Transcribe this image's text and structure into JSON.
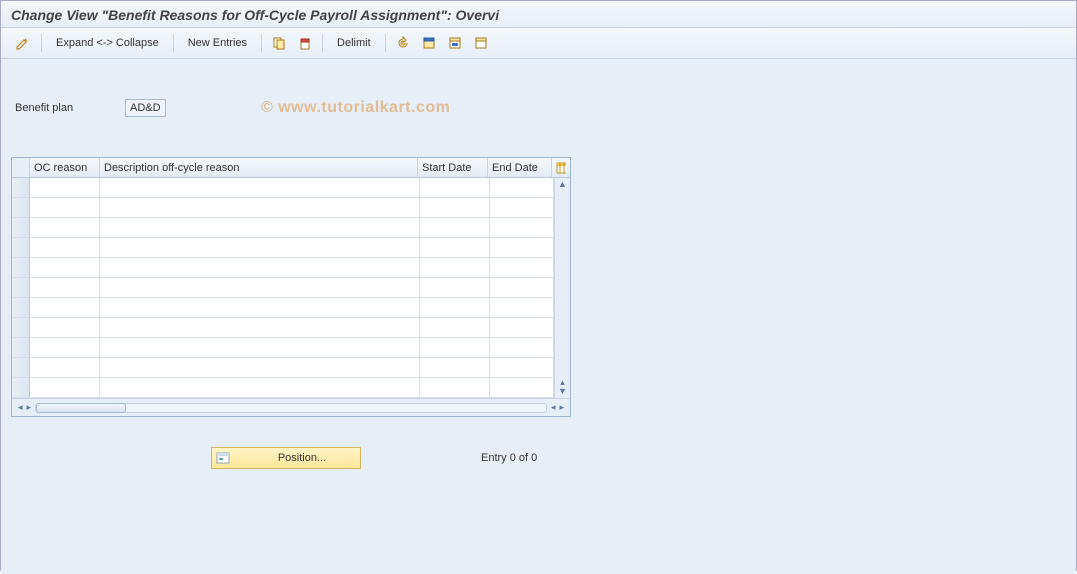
{
  "title": "Change View \"Benefit Reasons for Off-Cycle Payroll Assignment\": Overvi",
  "toolbar": {
    "expand_collapse": "Expand <-> Collapse",
    "new_entries": "New Entries",
    "delimit": "Delimit"
  },
  "field": {
    "label": "Benefit plan",
    "value": "AD&D"
  },
  "table": {
    "headers": {
      "oc": "OC reason",
      "desc": "Description off-cycle reason",
      "start": "Start Date",
      "end": "End Date"
    },
    "row_count": 11
  },
  "position_button": "Position...",
  "entry_status": "Entry 0 of 0",
  "watermark": "© www.tutorialkart.com"
}
